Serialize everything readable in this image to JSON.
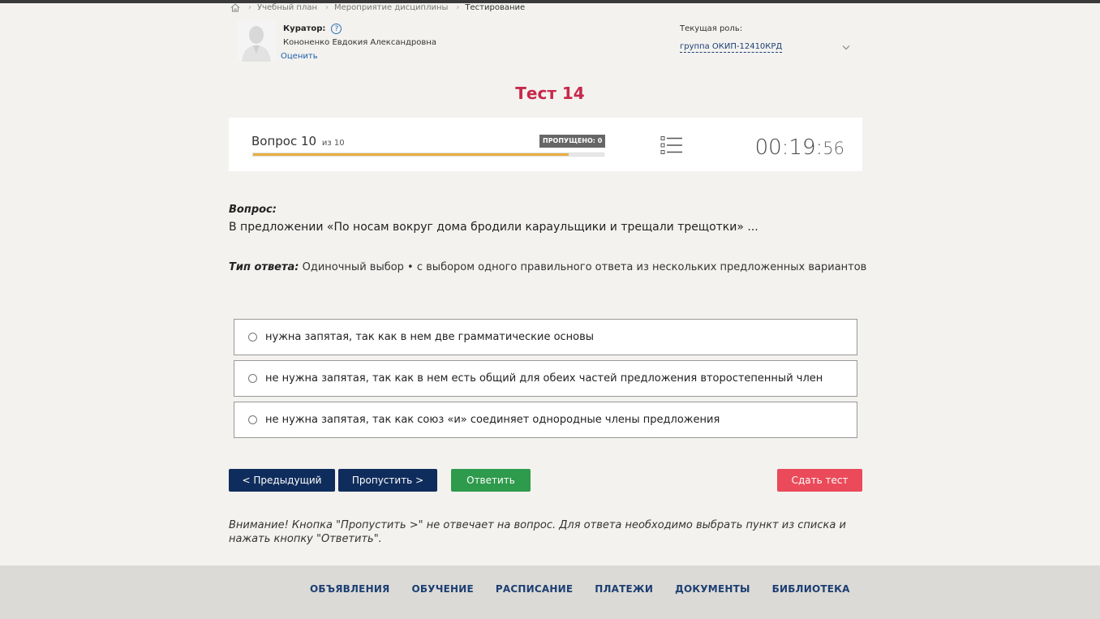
{
  "breadcrumb": {
    "home_icon": "home-icon",
    "items": [
      "Учебный план",
      "Мероприятие дисциплины",
      "Тестирование"
    ]
  },
  "curator": {
    "title": "Куратор:",
    "name": "Кононенко Евдокия Александровна",
    "rate_link": "Оценить",
    "help_icon": "?"
  },
  "role": {
    "label": "Текущая роль:",
    "value": "группа ОКИП-12410КРД"
  },
  "test": {
    "title": "Тест 14"
  },
  "progress": {
    "question_label": "Вопрос 10",
    "of_label": "из 10",
    "skipped_label": "ПРОПУЩЕНО: 0",
    "fill_fraction": 0.9,
    "timer_main": "00:19:",
    "timer_seconds": "56"
  },
  "question": {
    "label": "Вопрос:",
    "text": "В предложении «По носам вокруг дома бродили караульщики и трещали трещотки» ...",
    "answer_type_label": "Тип ответа:",
    "answer_type_value": " Одиночный выбор • с выбором одного правильного ответа из нескольких предложенных вариантов"
  },
  "options": [
    "нужна запятая, так как в нем две грамматические основы",
    "не нужна запятая, так как в нем есть общий для обеих частей предложения второстепенный член",
    "не нужна запятая, так как союз «и» соединяет однородные члены предложения"
  ],
  "buttons": {
    "prev": "< Предыдущий",
    "skip": "Пропустить >",
    "answer": "Ответить",
    "finish": "Сдать тест"
  },
  "notice": "Внимание! Кнопка \"Пропустить >\" не отвечает на вопрос. Для ответа необходимо выбрать пункт из списка и нажать кнопку \"Ответить\".",
  "footer": {
    "links": [
      "ОБЪЯВЛЕНИЯ",
      "ОБУЧЕНИЕ",
      "РАСПИСАНИЕ",
      "ПЛАТЕЖИ",
      "ДОКУМЕНТЫ",
      "БИБЛИОТЕКА"
    ]
  },
  "colors": {
    "title": "#c8284a",
    "primary_button": "#0f2d5c",
    "answer_button": "#2e9a4c",
    "finish_button": "#ea4a5a",
    "progress_fill": "#e8b040"
  }
}
